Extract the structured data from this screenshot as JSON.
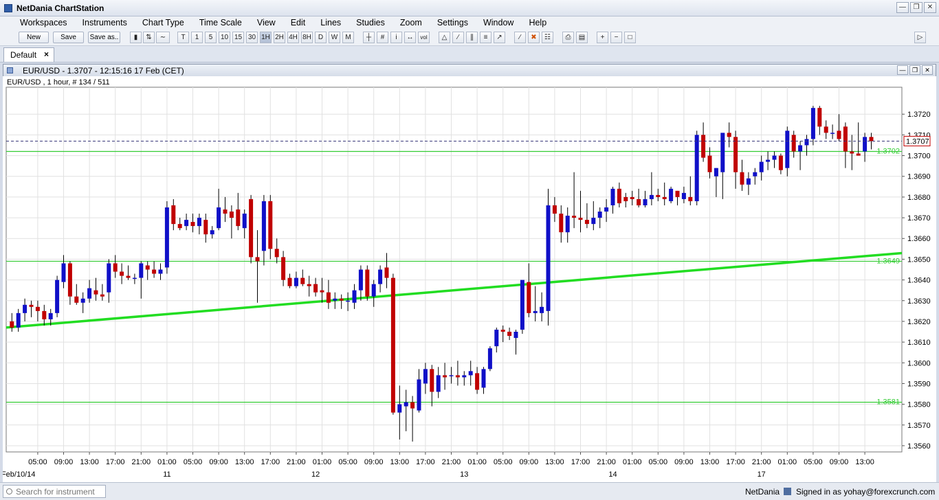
{
  "app": {
    "title": "NetDania ChartStation"
  },
  "menu": [
    "Workspaces",
    "Instruments",
    "Chart Type",
    "Time Scale",
    "View",
    "Edit",
    "Lines",
    "Studies",
    "Zoom",
    "Settings",
    "Window",
    "Help"
  ],
  "toolbar": {
    "new_label": "New",
    "save_label": "Save",
    "save_as_label": "Save as..",
    "interval_buttons": [
      "T",
      "1",
      "5",
      "10",
      "15",
      "30",
      "1H",
      "2H",
      "4H",
      "8H",
      "D",
      "W",
      "M"
    ],
    "active_interval": "1H",
    "volume_label": "vol"
  },
  "workspace_tab": {
    "label": "Default",
    "close": "×"
  },
  "chart_window": {
    "title": "EUR/USD - 1.3707 - 12:15:16  17 Feb (CET)",
    "info": "EUR/USD , 1 hour, # 134 / 511"
  },
  "colors": {
    "bull": "#1010c8",
    "bear": "#c00000",
    "line": "#22dd22",
    "hline": "#33cc33"
  },
  "chart_data": {
    "type": "candlestick",
    "symbol": "EUR/USD",
    "interval": "1 hour",
    "ylim": [
      1.3557,
      1.3733
    ],
    "y_ticks": [
      "1.3560",
      "1.3570",
      "1.3580",
      "1.3590",
      "1.3600",
      "1.3610",
      "1.3620",
      "1.3630",
      "1.3640",
      "1.3650",
      "1.3660",
      "1.3670",
      "1.3680",
      "1.3690",
      "1.3700",
      "1.3710",
      "1.3720"
    ],
    "x_ticks": [
      {
        "i": 4,
        "label": "05:00"
      },
      {
        "i": 8,
        "label": "09:00"
      },
      {
        "i": 12,
        "label": "13:00"
      },
      {
        "i": 16,
        "label": "17:00"
      },
      {
        "i": 20,
        "label": "21:00"
      },
      {
        "i": 24,
        "label": "01:00"
      },
      {
        "i": 28,
        "label": "05:00"
      },
      {
        "i": 32,
        "label": "09:00"
      },
      {
        "i": 36,
        "label": "13:00"
      },
      {
        "i": 40,
        "label": "17:00"
      },
      {
        "i": 44,
        "label": "21:00"
      },
      {
        "i": 48,
        "label": "01:00"
      },
      {
        "i": 52,
        "label": "05:00"
      },
      {
        "i": 56,
        "label": "09:00"
      },
      {
        "i": 60,
        "label": "13:00"
      },
      {
        "i": 64,
        "label": "17:00"
      },
      {
        "i": 68,
        "label": "21:00"
      },
      {
        "i": 72,
        "label": "01:00"
      },
      {
        "i": 76,
        "label": "05:00"
      },
      {
        "i": 80,
        "label": "09:00"
      },
      {
        "i": 84,
        "label": "13:00"
      },
      {
        "i": 88,
        "label": "17:00"
      },
      {
        "i": 92,
        "label": "21:00"
      },
      {
        "i": 96,
        "label": "01:00"
      },
      {
        "i": 100,
        "label": "05:00"
      },
      {
        "i": 104,
        "label": "09:00"
      },
      {
        "i": 108,
        "label": "13:00"
      },
      {
        "i": 112,
        "label": "17:00"
      },
      {
        "i": 116,
        "label": "21:00"
      },
      {
        "i": 120,
        "label": "01:00"
      },
      {
        "i": 124,
        "label": "05:00"
      },
      {
        "i": 128,
        "label": "09:00"
      },
      {
        "i": 132,
        "label": "13:00"
      }
    ],
    "date_labels": [
      {
        "i": 1,
        "label": "Feb/10/14"
      },
      {
        "i": 24,
        "label": "11"
      },
      {
        "i": 47,
        "label": "12"
      },
      {
        "i": 70,
        "label": "13"
      },
      {
        "i": 93,
        "label": "14"
      },
      {
        "i": 116,
        "label": "17"
      }
    ],
    "last_price": "1.3707",
    "horizontal_lines": [
      {
        "value": 1.3702,
        "label": "1.3702"
      },
      {
        "value": 1.3649,
        "label": "1.3649"
      },
      {
        "value": 1.3581,
        "label": "1.3581"
      }
    ],
    "trendline": {
      "start": {
        "i": -1,
        "price": 1.3617
      },
      "end": {
        "i": 134,
        "price": 1.3652
      }
    },
    "candles": [
      [
        1.362,
        1.3624,
        1.3615,
        1.3617
      ],
      [
        1.3617,
        1.3626,
        1.3615,
        1.3624
      ],
      [
        1.3624,
        1.3631,
        1.362,
        1.3628
      ],
      [
        1.3628,
        1.363,
        1.3622,
        1.3627
      ],
      [
        1.3627,
        1.363,
        1.362,
        1.3625
      ],
      [
        1.3625,
        1.3628,
        1.3618,
        1.3621
      ],
      [
        1.3621,
        1.3626,
        1.3618,
        1.3624
      ],
      [
        1.3624,
        1.3642,
        1.3622,
        1.364
      ],
      [
        1.3639,
        1.3652,
        1.3636,
        1.3648
      ],
      [
        1.3648,
        1.3649,
        1.3628,
        1.3632
      ],
      [
        1.3632,
        1.3638,
        1.3628,
        1.3629
      ],
      [
        1.3629,
        1.3634,
        1.3624,
        1.3631
      ],
      [
        1.3631,
        1.364,
        1.3629,
        1.3636
      ],
      [
        1.3635,
        1.3641,
        1.363,
        1.3633
      ],
      [
        1.3633,
        1.3638,
        1.363,
        1.3632
      ],
      [
        1.3634,
        1.365,
        1.3629,
        1.3648
      ],
      [
        1.3648,
        1.3652,
        1.3641,
        1.3644
      ],
      [
        1.3644,
        1.3648,
        1.3638,
        1.3642
      ],
      [
        1.3642,
        1.3647,
        1.364,
        1.3641
      ],
      [
        1.3641,
        1.3643,
        1.3638,
        1.3641
      ],
      [
        1.3641,
        1.3649,
        1.3631,
        1.3648
      ],
      [
        1.3647,
        1.3649,
        1.364,
        1.3645
      ],
      [
        1.3645,
        1.3649,
        1.3641,
        1.3643
      ],
      [
        1.3643,
        1.3648,
        1.364,
        1.3645
      ],
      [
        1.3646,
        1.3678,
        1.3643,
        1.3675
      ],
      [
        1.3676,
        1.3679,
        1.3664,
        1.3667
      ],
      [
        1.3667,
        1.367,
        1.3664,
        1.3665
      ],
      [
        1.3666,
        1.3672,
        1.3664,
        1.3669
      ],
      [
        1.3668,
        1.3672,
        1.3663,
        1.3666
      ],
      [
        1.3666,
        1.3672,
        1.3662,
        1.367
      ],
      [
        1.3669,
        1.3672,
        1.3658,
        1.3662
      ],
      [
        1.3662,
        1.3666,
        1.366,
        1.3664
      ],
      [
        1.3665,
        1.3684,
        1.3664,
        1.3675
      ],
      [
        1.3674,
        1.368,
        1.3668,
        1.3672
      ],
      [
        1.3673,
        1.3676,
        1.366,
        1.367
      ],
      [
        1.3674,
        1.3682,
        1.3664,
        1.3666
      ],
      [
        1.3665,
        1.3674,
        1.366,
        1.3672
      ],
      [
        1.3679,
        1.3681,
        1.3648,
        1.3651
      ],
      [
        1.3651,
        1.3664,
        1.3629,
        1.3649
      ],
      [
        1.3654,
        1.3681,
        1.3647,
        1.3678
      ],
      [
        1.3678,
        1.3681,
        1.365,
        1.3655
      ],
      [
        1.3655,
        1.366,
        1.3648,
        1.3651
      ],
      [
        1.3651,
        1.3654,
        1.3637,
        1.364
      ],
      [
        1.3641,
        1.3643,
        1.3636,
        1.3637
      ],
      [
        1.3637,
        1.3644,
        1.3636,
        1.3641
      ],
      [
        1.3641,
        1.3645,
        1.3637,
        1.3638
      ],
      [
        1.3638,
        1.3642,
        1.3632,
        1.3637
      ],
      [
        1.3638,
        1.3641,
        1.3632,
        1.3634
      ],
      [
        1.3635,
        1.3641,
        1.3629,
        1.3634
      ],
      [
        1.3634,
        1.364,
        1.3626,
        1.3629
      ],
      [
        1.363,
        1.3634,
        1.3626,
        1.3631
      ],
      [
        1.3631,
        1.3633,
        1.3626,
        1.363
      ],
      [
        1.363,
        1.3634,
        1.3625,
        1.363
      ],
      [
        1.3629,
        1.3638,
        1.3626,
        1.3635
      ],
      [
        1.3635,
        1.3647,
        1.363,
        1.3645
      ],
      [
        1.3645,
        1.3647,
        1.363,
        1.3632
      ],
      [
        1.3632,
        1.364,
        1.3627,
        1.3638
      ],
      [
        1.3638,
        1.3647,
        1.3634,
        1.3645
      ],
      [
        1.3646,
        1.3653,
        1.3636,
        1.3641
      ],
      [
        1.3641,
        1.3643,
        1.3575,
        1.3576
      ],
      [
        1.3576,
        1.3589,
        1.3563,
        1.358
      ],
      [
        1.3579,
        1.3587,
        1.3567,
        1.3581
      ],
      [
        1.3581,
        1.3584,
        1.3562,
        1.3578
      ],
      [
        1.3577,
        1.3597,
        1.3576,
        1.3592
      ],
      [
        1.359,
        1.36,
        1.3585,
        1.3597
      ],
      [
        1.3597,
        1.3599,
        1.3579,
        1.3586
      ],
      [
        1.3586,
        1.3598,
        1.3583,
        1.3594
      ],
      [
        1.3594,
        1.36,
        1.3587,
        1.3593
      ],
      [
        1.3594,
        1.3598,
        1.359,
        1.3594
      ],
      [
        1.3594,
        1.3601,
        1.3589,
        1.3593
      ],
      [
        1.3593,
        1.3596,
        1.3589,
        1.3594
      ],
      [
        1.3594,
        1.3601,
        1.3589,
        1.3596
      ],
      [
        1.3595,
        1.3598,
        1.3585,
        1.3587
      ],
      [
        1.3588,
        1.3598,
        1.3585,
        1.3597
      ],
      [
        1.3597,
        1.3608,
        1.3596,
        1.3607
      ],
      [
        1.3608,
        1.3617,
        1.3605,
        1.3616
      ],
      [
        1.3616,
        1.3618,
        1.361,
        1.3615
      ],
      [
        1.3615,
        1.3617,
        1.3611,
        1.3613
      ],
      [
        1.3612,
        1.3616,
        1.3604,
        1.3615
      ],
      [
        1.3616,
        1.3638,
        1.3614,
        1.364
      ],
      [
        1.3639,
        1.3648,
        1.3622,
        1.3624
      ],
      [
        1.3624,
        1.3637,
        1.362,
        1.3625
      ],
      [
        1.3624,
        1.3634,
        1.362,
        1.3627
      ],
      [
        1.3625,
        1.3684,
        1.3618,
        1.3676
      ],
      [
        1.3676,
        1.368,
        1.3668,
        1.3672
      ],
      [
        1.3672,
        1.3676,
        1.3658,
        1.3663
      ],
      [
        1.3663,
        1.3675,
        1.3658,
        1.3671
      ],
      [
        1.3671,
        1.3692,
        1.3665,
        1.367
      ],
      [
        1.367,
        1.3683,
        1.3663,
        1.3669
      ],
      [
        1.3669,
        1.3677,
        1.3665,
        1.3667
      ],
      [
        1.3667,
        1.3678,
        1.3664,
        1.367
      ],
      [
        1.367,
        1.3675,
        1.3665,
        1.3673
      ],
      [
        1.3673,
        1.3679,
        1.3668,
        1.3675
      ],
      [
        1.3676,
        1.3685,
        1.3672,
        1.3684
      ],
      [
        1.3684,
        1.3687,
        1.3675,
        1.3677
      ],
      [
        1.368,
        1.3682,
        1.3675,
        1.3678
      ],
      [
        1.368,
        1.3683,
        1.3676,
        1.3679
      ],
      [
        1.3679,
        1.3684,
        1.3675,
        1.3676
      ],
      [
        1.3676,
        1.3683,
        1.3675,
        1.3679
      ],
      [
        1.3679,
        1.3692,
        1.3676,
        1.3681
      ],
      [
        1.3681,
        1.3684,
        1.3678,
        1.368
      ],
      [
        1.368,
        1.3687,
        1.3676,
        1.3679
      ],
      [
        1.3678,
        1.3685,
        1.3677,
        1.3684
      ],
      [
        1.3683,
        1.3683,
        1.3676,
        1.368
      ],
      [
        1.3679,
        1.3685,
        1.3677,
        1.3682
      ],
      [
        1.368,
        1.369,
        1.3676,
        1.3678
      ],
      [
        1.3678,
        1.3712,
        1.3676,
        1.371
      ],
      [
        1.371,
        1.3716,
        1.3697,
        1.3699
      ],
      [
        1.37,
        1.3704,
        1.3689,
        1.3692
      ],
      [
        1.369,
        1.3694,
        1.368,
        1.3694
      ],
      [
        1.3692,
        1.371,
        1.3679,
        1.3711
      ],
      [
        1.3711,
        1.3716,
        1.3704,
        1.3709
      ],
      [
        1.3709,
        1.3712,
        1.3684,
        1.3692
      ],
      [
        1.3692,
        1.3698,
        1.3683,
        1.3686
      ],
      [
        1.3686,
        1.3692,
        1.3681,
        1.3689
      ],
      [
        1.369,
        1.3694,
        1.3686,
        1.3692
      ],
      [
        1.3692,
        1.37,
        1.3688,
        1.3697
      ],
      [
        1.3697,
        1.3702,
        1.3693,
        1.3698
      ],
      [
        1.3698,
        1.3702,
        1.3694,
        1.37
      ],
      [
        1.37,
        1.3701,
        1.3691,
        1.3693
      ],
      [
        1.3694,
        1.3714,
        1.369,
        1.3712
      ],
      [
        1.371,
        1.3712,
        1.3699,
        1.3702
      ],
      [
        1.3702,
        1.3707,
        1.3693,
        1.3705
      ],
      [
        1.3705,
        1.371,
        1.37,
        1.3708
      ],
      [
        1.3708,
        1.3724,
        1.3705,
        1.3723
      ],
      [
        1.3723,
        1.3724,
        1.371,
        1.3714
      ],
      [
        1.3714,
        1.3717,
        1.3708,
        1.3711
      ],
      [
        1.3711,
        1.3715,
        1.3708,
        1.3711
      ],
      [
        1.3712,
        1.372,
        1.3707,
        1.3708
      ],
      [
        1.3714,
        1.3716,
        1.3694,
        1.3702
      ],
      [
        1.3702,
        1.371,
        1.3693,
        1.3701
      ],
      [
        1.3701,
        1.3716,
        1.37,
        1.37
      ],
      [
        1.3702,
        1.3711,
        1.3697,
        1.3709
      ],
      [
        1.3709,
        1.3711,
        1.3703,
        1.3707
      ]
    ]
  },
  "statusbar": {
    "search_placeholder": "Search for instrument",
    "brand": "NetDania",
    "signed_in": "Signed in as yohay@forexcrunch.com"
  }
}
